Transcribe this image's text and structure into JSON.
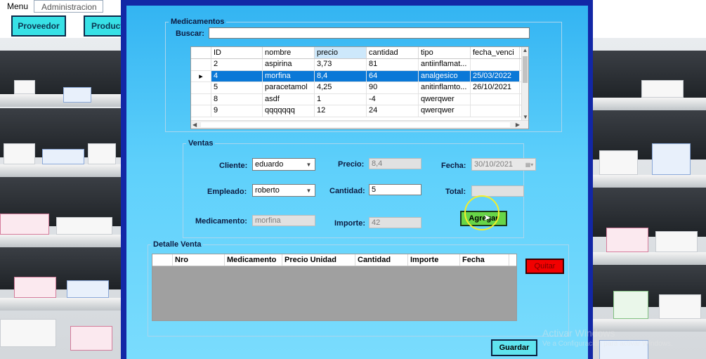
{
  "menu": {
    "items": [
      "Menu",
      "Administracion"
    ]
  },
  "background": {
    "buttons": [
      "Proveedor",
      "Producto"
    ]
  },
  "medicamentos": {
    "legend": "Medicamentos",
    "search_label": "Buscar:",
    "search_value": "",
    "columns": [
      "ID",
      "nombre",
      "precio",
      "cantidad",
      "tipo",
      "fecha_venci"
    ],
    "rows": [
      [
        "2",
        "aspirina",
        "3,73",
        "81",
        "antiinflamat...",
        ""
      ],
      [
        "4",
        "morfina",
        "8,4",
        "64",
        "analgesico",
        "25/03/2022"
      ],
      [
        "5",
        "paracetamol",
        "4,25",
        "90",
        "anitinflamto...",
        "26/10/2021"
      ],
      [
        "8",
        "asdf",
        "1",
        "-4",
        "qwerqwer",
        ""
      ],
      [
        "9",
        "qqqqqqq",
        "12",
        "24",
        "qwerqwer",
        ""
      ]
    ],
    "selected_row": 1
  },
  "ventas": {
    "legend": "Ventas",
    "cliente_label": "Cliente:",
    "cliente_value": "eduardo",
    "empleado_label": "Empleado:",
    "empleado_value": "roberto",
    "medicamento_label": "Medicamento:",
    "medicamento_value": "morfina",
    "precio_label": "Precio:",
    "precio_value": "8,4",
    "cantidad_label": "Cantidad:",
    "cantidad_value": "5",
    "importe_label": "Importe:",
    "importe_value": "42",
    "fecha_label": "Fecha:",
    "fecha_value": "30/10/2021",
    "total_label": "Total:",
    "total_value": "",
    "agregar_label": "Agregar"
  },
  "detalle": {
    "legend": "Detalle Venta",
    "columns": [
      "Nro",
      "Medicamento",
      "Precio Unidad",
      "Cantidad",
      "Importe",
      "Fecha"
    ],
    "quitar_label": "Quitar",
    "guardar_label": "Guardar"
  },
  "colors": {
    "dialog_border": "#1227a6",
    "client_bg": "#33b4f2",
    "selected_row": "#0a78d7",
    "agregar_bg": "#67d548",
    "quitar_bg": "#f20000",
    "guardar_bg": "#5fe3ee",
    "bg_button": "#38e1e6"
  },
  "watermark": [
    "Activar Windows",
    "Ve a Configuración para activar Windows."
  ]
}
